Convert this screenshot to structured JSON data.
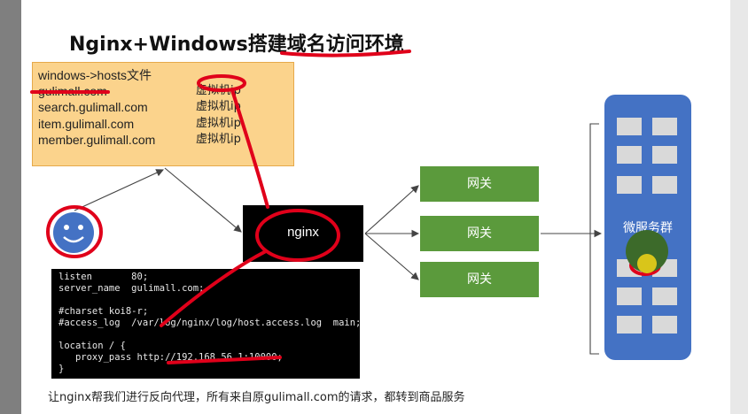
{
  "title": "Nginx+Windows搭建域名访问环境",
  "hosts": {
    "header": "windows->hosts文件",
    "rows": [
      {
        "domain": "gulimall.com",
        "ip": "虚拟机ip"
      },
      {
        "domain": "search.gulimall.com",
        "ip": "虚拟机ip"
      },
      {
        "domain": "item.gulimall.com",
        "ip": "虚拟机ip"
      },
      {
        "domain": "member.gulimall.com",
        "ip": "虚拟机ip"
      }
    ]
  },
  "nginx_label": "nginx",
  "gateways": [
    "网关",
    "网关",
    "网关"
  ],
  "microservices_label": "微服务群",
  "config_lines": [
    "listen       80;",
    "server_name  gulimall.com;",
    "",
    "#charset koi8-r;",
    "#access_log  /var/log/nginx/log/host.access.log  main;",
    "",
    "location / {",
    "   proxy_pass http://192.168.56.1:10000;",
    "}"
  ],
  "caption": "让nginx帮我们进行反向代理，所有来自原gulimall.com的请求，都转到商品服务",
  "colors": {
    "hosts_fill": "#fbd38c",
    "gateway_fill": "#5b9a3c",
    "cluster_fill": "#4472c4",
    "annotation_red": "#e0001a"
  }
}
